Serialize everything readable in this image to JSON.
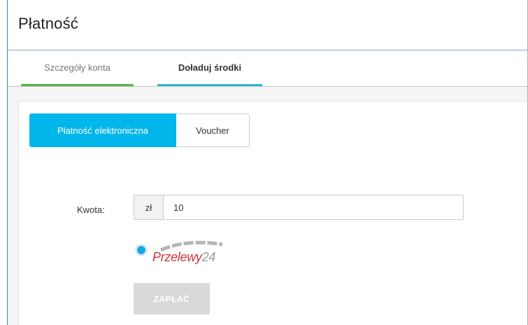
{
  "page": {
    "title": "Płatność"
  },
  "tabs": [
    {
      "label": "Szczegóły konta",
      "active": false,
      "accent": "#53b648"
    },
    {
      "label": "Doładuj środki",
      "active": true,
      "accent": "#2fb3e0"
    }
  ],
  "payment_methods": {
    "electronic_label": "Płatność elektroniczna",
    "voucher_label": "Voucher",
    "selected": "Płatność elektroniczna",
    "selected_color": "#00b6ea"
  },
  "amount": {
    "label": "Kwota:",
    "currency": "zł",
    "value": "10"
  },
  "provider": {
    "selected": true,
    "logo_text_primary": "Przelewy",
    "logo_text_secondary": "24",
    "logo_color": "#d13239"
  },
  "pay_button": {
    "label": "ZAPŁAĆ",
    "disabled": true
  }
}
